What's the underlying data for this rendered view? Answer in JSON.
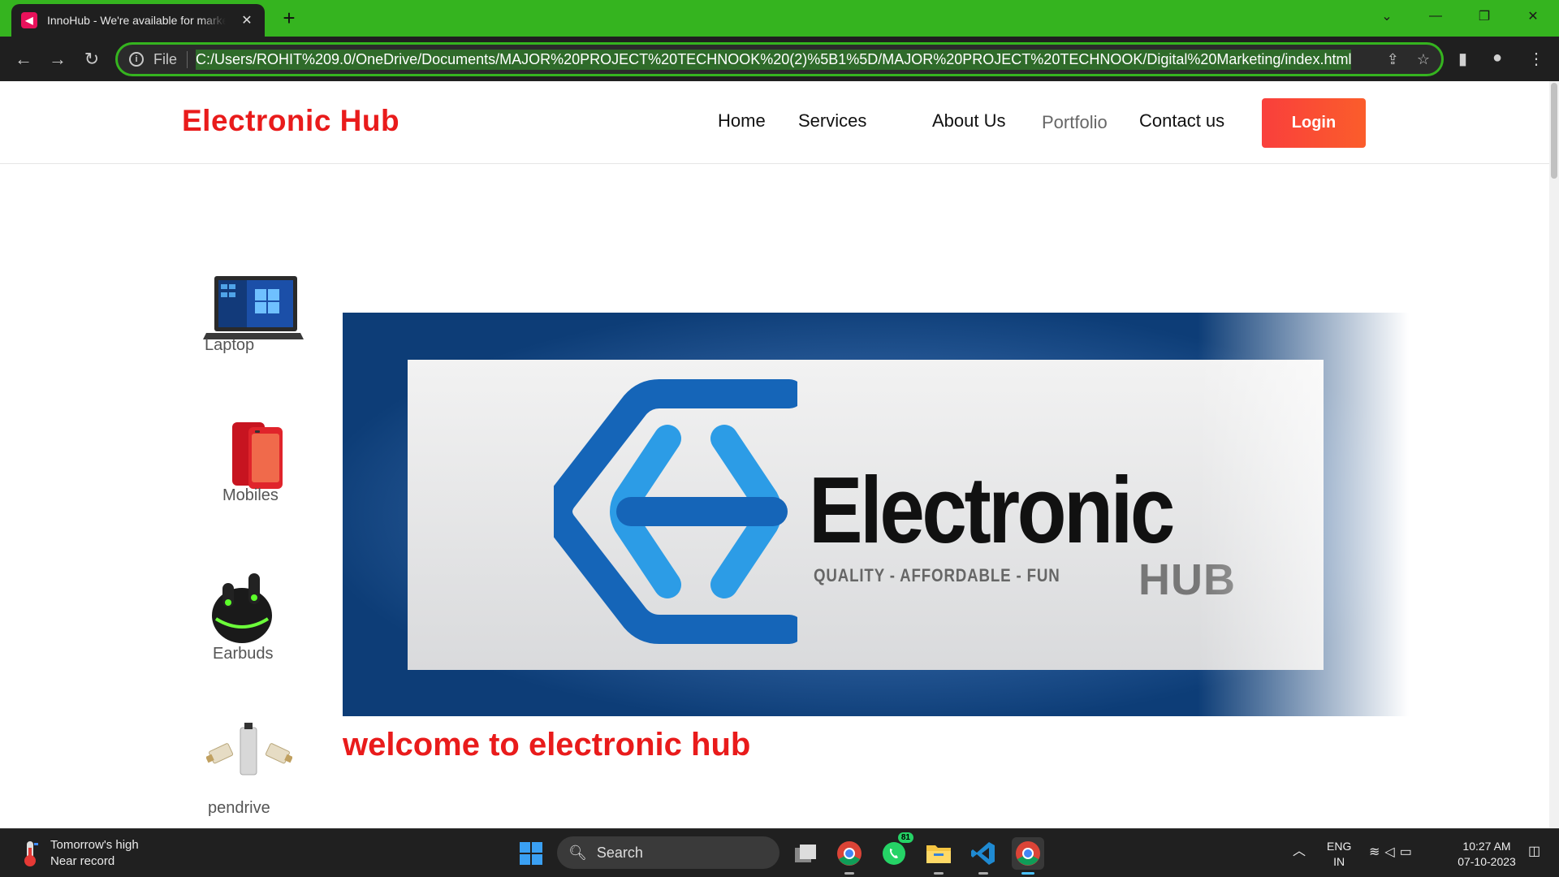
{
  "browser": {
    "tab_title": "InnoHub - We're available for marketing",
    "tab_favicon": "megaphone-icon",
    "new_tab": "+",
    "protocol_label": "File",
    "url": "C:/Users/ROHIT%209.0/OneDrive/Documents/MAJOR%20PROJECT%20TECHNOOK%20(2)%5B1%5D/MAJOR%20PROJECT%20TECHNOOK/Digital%20Marketing/index.html",
    "accent_color": "#35b41f"
  },
  "site": {
    "brand": "Electronic Hub",
    "brand_color": "#e91b1b",
    "nav": [
      {
        "label": "Home"
      },
      {
        "label": "Services"
      },
      {
        "label": "About Us"
      },
      {
        "label": "Portfolio"
      },
      {
        "label": "Contact us"
      }
    ],
    "login_label": "Login"
  },
  "categories": [
    {
      "label": "Laptop",
      "icon": "laptop-icon"
    },
    {
      "label": "Mobiles",
      "icon": "mobile-phone-icon"
    },
    {
      "label": "Earbuds",
      "icon": "earbuds-icon"
    },
    {
      "label": "pendrive",
      "icon": "pendrive-icon"
    }
  ],
  "banner": {
    "logo_word": "Electronic",
    "logo_tagline": "QUALITY - AFFORDABLE - FUN",
    "logo_hub": "HUB"
  },
  "welcome_text": "welcome to electronic hub",
  "taskbar": {
    "weather_line1": "Tomorrow's high",
    "weather_line2": "Near record",
    "search_label": "Search",
    "whatsapp_badge": "81",
    "lang_line1": "ENG",
    "lang_line2": "IN",
    "time": "10:27 AM",
    "date": "07-10-2023"
  }
}
